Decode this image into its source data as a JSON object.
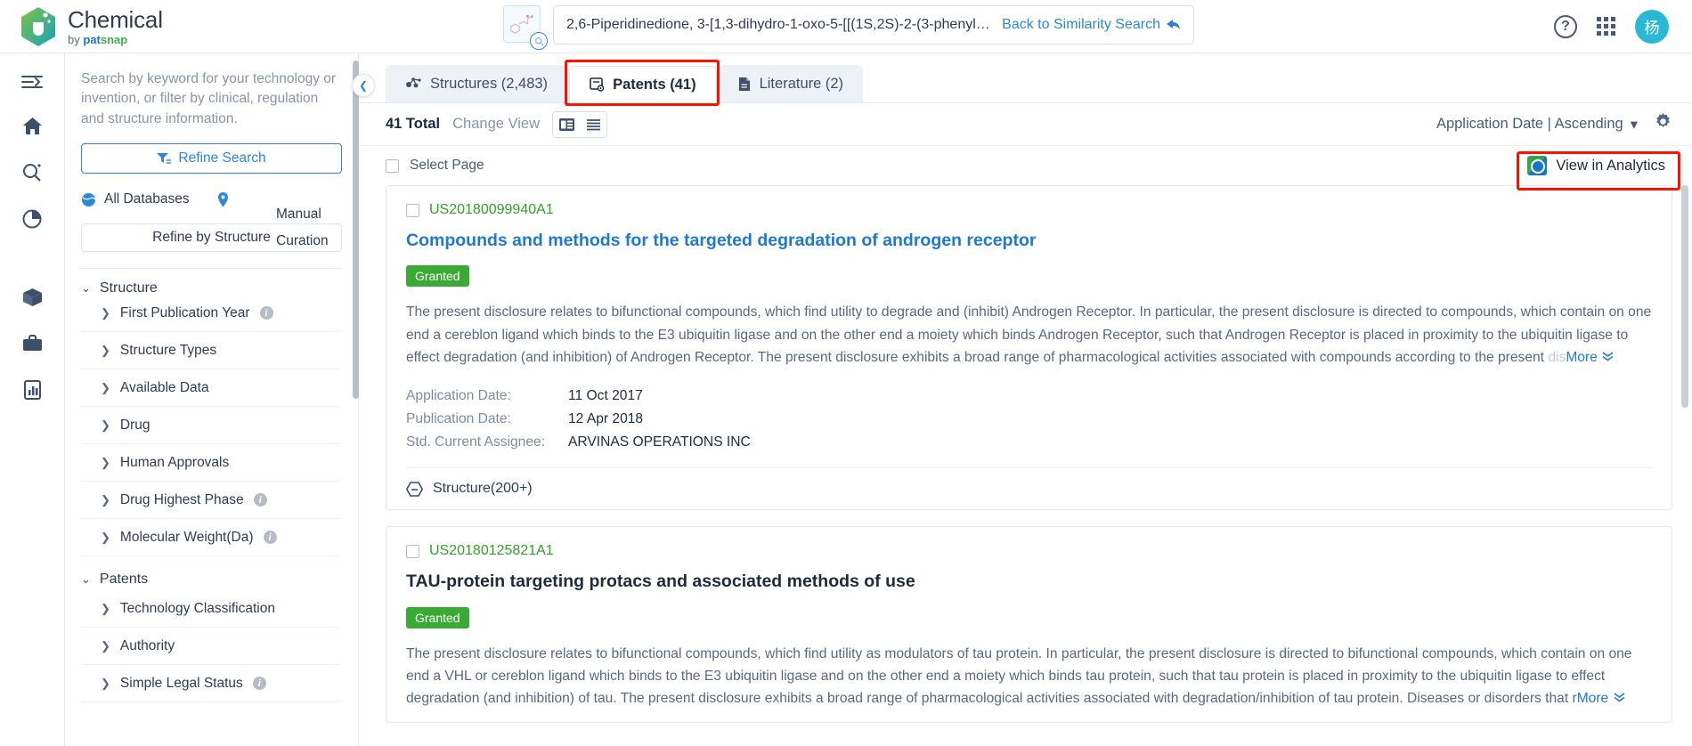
{
  "brand": {
    "title": "Chemical",
    "by": "by",
    "pat": "pat",
    "snap": "snap"
  },
  "search": {
    "value": "2,6-Piperidinedione, 3-[1,3-dihydro-1-oxo-5-[[(1S,2S)-2-(3-phenyl-1-a…",
    "back_label": "Back to Similarity Search",
    "back_arrow": "➜",
    "thumb_name": "structure-thumbnail",
    "zoom_icon": "magnifier-icon"
  },
  "topbar_right": {
    "help": "?",
    "apps_icon": "apps-grid-icon",
    "avatar_initial": "杨"
  },
  "rail": {
    "items": [
      {
        "name": "menu-toggle",
        "icon": "menu-arrow-icon"
      },
      {
        "name": "home",
        "icon": "home-icon"
      },
      {
        "name": "search",
        "icon": "search-icon"
      },
      {
        "name": "analytics",
        "icon": "pie-chart-icon"
      },
      {
        "name": "library",
        "icon": "box-icon"
      },
      {
        "name": "workspace",
        "icon": "briefcase-icon"
      },
      {
        "name": "reports",
        "icon": "report-icon"
      }
    ]
  },
  "filters": {
    "hint": "Search by keyword for your technology or invention, or filter by clinical, regulation and structure information.",
    "refine_search": "Refine Search",
    "all_databases": "All Databases",
    "manual_curation_line1": "Manual",
    "manual_curation_line2": "Curation",
    "refine_by_structure": "Refine by Structure",
    "groups": [
      {
        "label": "Structure",
        "expanded": true,
        "items": [
          {
            "label": "First Publication Year",
            "info": true
          },
          {
            "label": "Structure Types",
            "info": false
          },
          {
            "label": "Available Data",
            "info": false
          },
          {
            "label": "Drug",
            "info": false
          },
          {
            "label": "Human Approvals",
            "info": false
          },
          {
            "label": "Drug Highest Phase",
            "info": true
          },
          {
            "label": "Molecular Weight(Da)",
            "info": true
          }
        ]
      },
      {
        "label": "Patents",
        "expanded": true,
        "items": [
          {
            "label": "Technology Classification",
            "info": false
          },
          {
            "label": "Authority",
            "info": false
          },
          {
            "label": "Simple Legal Status",
            "info": true
          }
        ]
      }
    ]
  },
  "tabs": [
    {
      "label": "Structures (2,483)",
      "icon": "molecule-icon",
      "active": false
    },
    {
      "label": "Patents (41)",
      "icon": "patent-doc-icon",
      "active": true,
      "highlighted": true
    },
    {
      "label": "Literature (2)",
      "icon": "literature-doc-icon",
      "active": false
    }
  ],
  "toolbar": {
    "total": "41 Total",
    "change_view": "Change View",
    "view_card_icon": "card-view-icon",
    "view_list_icon": "list-view-icon",
    "sort_label": "Application Date | Ascending",
    "sort_caret": "▾",
    "settings_icon": "gear-icon"
  },
  "select_row": {
    "select_page": "Select Page",
    "view_in_analytics": "View in Analytics",
    "analytics_icon": "analytics-globe-icon",
    "highlight_color": "#ff1100"
  },
  "results": [
    {
      "pub_id": "US20180099940A1",
      "title": "Compounds and methods for the targeted degradation of androgen receptor",
      "title_color": "blue",
      "status": "Granted",
      "abstract": "The present disclosure relates to bifunctional compounds, which find utility to degrade and (inhibit) Androgen Receptor. In particular, the present disclosure is directed to compounds, which contain on one end a cereblon ligand which binds to the E3 ubiquitin ligase and on the other end a moiety which binds Androgen Receptor, such that Androgen Receptor is placed in proximity to the ubiquitin ligase to effect degradation (and inhibition) of Androgen Receptor. The present disclosure exhibits a broad range of pharmacological activities associated with compounds according to the present",
      "abstract_tail": " dis",
      "more_label": "More",
      "meta": [
        {
          "key": "Application Date:",
          "value": "11 Oct 2017"
        },
        {
          "key": "Publication Date:",
          "value": "12 Apr 2018"
        },
        {
          "key": "Std. Current Assignee:",
          "value": "ARVINAS OPERATIONS INC"
        }
      ],
      "structure_label": "Structure(200+)",
      "structure_icon": "hexagon-structure-icon"
    },
    {
      "pub_id": "US20180125821A1",
      "title": "TAU-protein targeting protacs and associated methods of use",
      "title_color": "dark",
      "status": "Granted",
      "abstract": "The present disclosure relates to bifunctional compounds, which find utility as modulators of tau protein. In particular, the present disclosure is directed to bifunctional compounds, which contain on one end a VHL or cereblon ligand which binds to the E3 ubiquitin ligase and on the other end a moiety which binds tau protein, such that tau protein is placed in proximity to the ubiquitin ligase to effect degradation (and inhibition) of tau. The present disclosure exhibits a broad range of pharmacological activities associated with degradation/inhibition of tau protein. Diseases or disorders that r",
      "abstract_tail": "",
      "more_label": "More",
      "meta": [],
      "structure_label": "",
      "structure_icon": ""
    }
  ],
  "colors": {
    "accent_blue": "#1f78d1",
    "green": "#33a02c",
    "badge_green": "#3aa935",
    "highlight_red": "#ff1100"
  }
}
